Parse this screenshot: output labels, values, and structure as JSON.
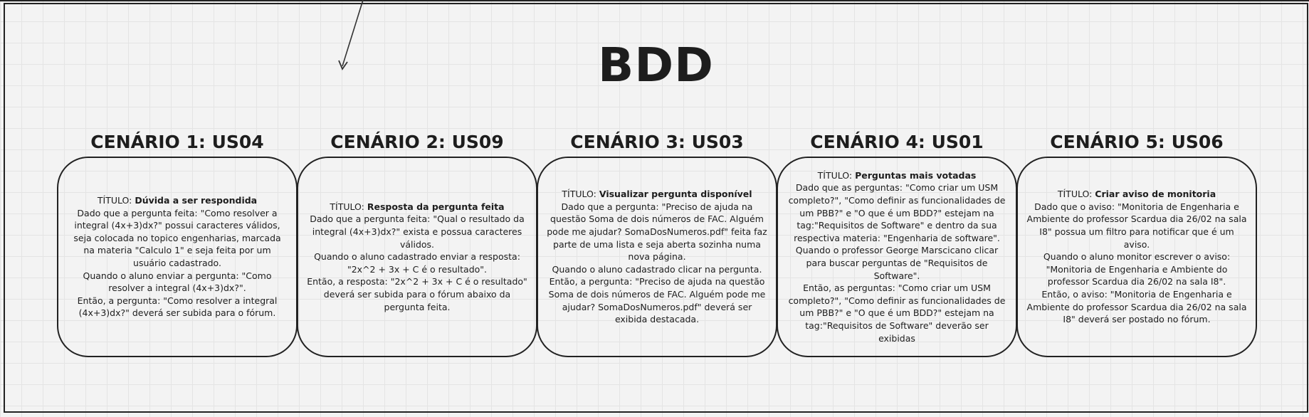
{
  "board": {
    "title": "BDD"
  },
  "scenarios": [
    {
      "heading": "CENÁRIO 1: US04",
      "titulo_label": "TÍTULO: ",
      "titulo_value": "Dúvida a ser respondida",
      "lines": [
        "Dado que a pergunta feita: \"Como resolver a integral (4x+3)dx?\" possui caracteres válidos, seja colocada no topico engenharias, marcada na materia \"Calculo 1\" e seja feita por um usuário cadastrado.",
        "Quando o aluno enviar a pergunta: \"Como resolver a integral (4x+3)dx?\".",
        "Então, a pergunta: \"Como resolver a integral (4x+3)dx?\" deverá ser subida para o fórum."
      ]
    },
    {
      "heading": "CENÁRIO 2: US09",
      "titulo_label": "TÍTULO: ",
      "titulo_value": "Resposta da pergunta feita",
      "lines": [
        "Dado que a pergunta feita: \"Qual o resultado da integral (4x+3)dx?\" exista e possua caracteres válidos.",
        "Quando o aluno cadastrado enviar a resposta: \"2x^2 + 3x + C é o resultado\".",
        "Então, a resposta: \"2x^2 + 3x + C é o resultado\" deverá ser subida para o fórum abaixo da pergunta feita."
      ]
    },
    {
      "heading": "CENÁRIO 3: US03",
      "titulo_label": "TÍTULO: ",
      "titulo_value": "Visualizar pergunta disponível",
      "lines": [
        "Dado que a pergunta: \"Preciso de ajuda na questão Soma de dois números de FAC. Alguém pode me ajudar? SomaDosNumeros.pdf\" feita faz parte de uma lista e seja aberta sozinha numa nova página.",
        "Quando o aluno cadastrado clicar na pergunta.",
        "Então, a pergunta: \"Preciso de ajuda na questão Soma de dois números de FAC. Alguém pode me ajudar? SomaDosNumeros.pdf\" deverá ser exibida destacada."
      ]
    },
    {
      "heading": "CENÁRIO 4: US01",
      "titulo_label": "TÍTULO: ",
      "titulo_value": "Perguntas mais votadas",
      "lines": [
        "Dado que as perguntas: \"Como criar um USM completo?\", \"Como definir as funcionalidades de um PBB?\" e \"O que é um BDD?\" estejam na tag:\"Requisitos de Software\" e dentro da sua respectiva materia: \"Engenharia de software\".",
        "Quando o professor George Marscicano clicar para buscar perguntas de \"Requisitos de Software\".",
        "Então, as perguntas: \"Como criar um USM completo?\", \"Como definir as funcionalidades de um PBB?\" e \"O que é um BDD?\" estejam na tag:\"Requisitos de Software\" deverão ser exibidas"
      ]
    },
    {
      "heading": "CENÁRIO 5: US06",
      "titulo_label": "TÍTULO: ",
      "titulo_value": "Criar aviso de monitoria",
      "lines": [
        "Dado que o aviso: \"Monitoria de Engenharia e Ambiente do professor Scardua dia 26/02 na sala I8\" possua um filtro para notificar que é um aviso.",
        "Quando o aluno monitor escrever o aviso: \"Monitoria de Engenharia e Ambiente do professor Scardua dia 26/02 na sala I8\".",
        "Então, o aviso: \"Monitoria de Engenharia e Ambiente do professor Scardua dia 26/02 na sala I8\" deverá ser postado no fórum."
      ]
    }
  ]
}
